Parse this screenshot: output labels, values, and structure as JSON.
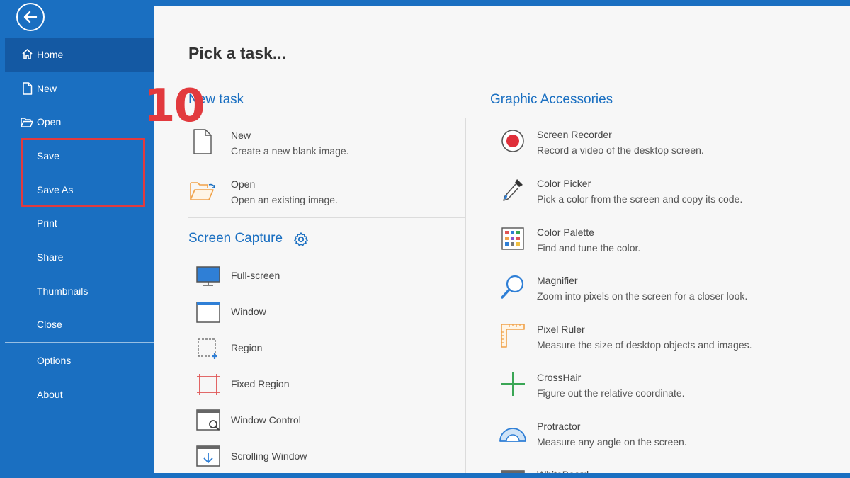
{
  "overlay": {
    "step_number": "10"
  },
  "sidebar": {
    "items": [
      {
        "label": "Home",
        "icon": "home-icon"
      },
      {
        "label": "New",
        "icon": "file-icon"
      },
      {
        "label": "Open",
        "icon": "folder-open-icon"
      },
      {
        "label": "Save"
      },
      {
        "label": "Save As"
      },
      {
        "label": "Print"
      },
      {
        "label": "Share"
      },
      {
        "label": "Thumbnails"
      },
      {
        "label": "Close"
      },
      {
        "label": "Options"
      },
      {
        "label": "About"
      }
    ],
    "active": "Home",
    "highlight_color": "#e23a3e"
  },
  "main": {
    "title": "Pick a task...",
    "new_task": {
      "title": "New task",
      "tasks": [
        {
          "name": "New",
          "desc": "Create a new blank image."
        },
        {
          "name": "Open",
          "desc": "Open an existing image."
        }
      ]
    },
    "screen_capture": {
      "title": "Screen Capture",
      "tasks": [
        {
          "name": "Full-screen"
        },
        {
          "name": "Window"
        },
        {
          "name": "Region"
        },
        {
          "name": "Fixed Region"
        },
        {
          "name": "Window Control"
        },
        {
          "name": "Scrolling Window"
        }
      ]
    },
    "graphic_accessories": {
      "title": "Graphic Accessories",
      "tasks": [
        {
          "name": "Screen Recorder",
          "desc": "Record a video of the desktop screen."
        },
        {
          "name": "Color Picker",
          "desc": "Pick a color from the screen and copy its code."
        },
        {
          "name": "Color Palette",
          "desc": "Find and tune the color."
        },
        {
          "name": "Magnifier",
          "desc": "Zoom into pixels on the screen for a closer look."
        },
        {
          "name": "Pixel Ruler",
          "desc": "Measure the size of desktop objects and images."
        },
        {
          "name": "CrossHair",
          "desc": "Figure out the relative coordinate."
        },
        {
          "name": "Protractor",
          "desc": "Measure any angle on the screen."
        },
        {
          "name": "WhiteBoard"
        }
      ]
    }
  },
  "colors": {
    "brand": "#1a6fc1",
    "accent_red": "#e23a3e",
    "panel": "#f7f7f7"
  }
}
